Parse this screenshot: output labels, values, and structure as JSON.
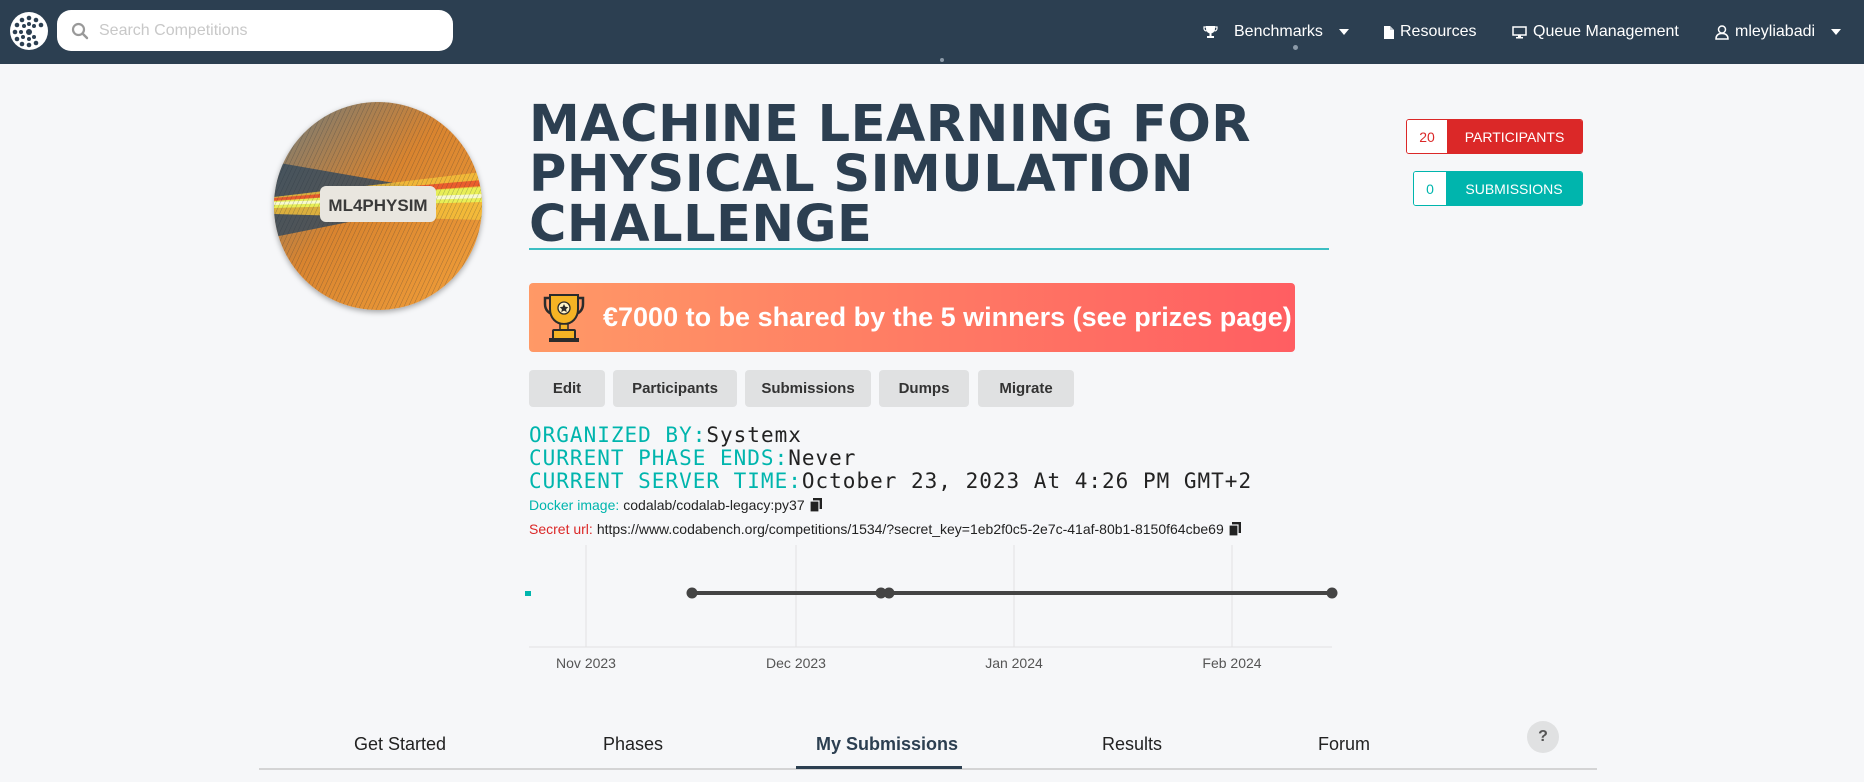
{
  "navbar": {
    "search_placeholder": "Search Competitions",
    "benchmarks_label": "Benchmarks",
    "resources_label": "Resources",
    "queue_label": "Queue Management",
    "user_label": "mleyliabadi"
  },
  "competition": {
    "logo_text": "ML4PHYSIM",
    "title": "MACHINE LEARNING FOR PHYSICAL SIMULATION CHALLENGE",
    "participants_count": "20",
    "participants_label": "PARTICIPANTS",
    "submissions_count": "0",
    "submissions_label": "SUBMISSIONS",
    "prize_text": "€7000 to be shared by the 5 winners (see prizes page)"
  },
  "actions": {
    "edit": "Edit",
    "participants": "Participants",
    "submissions": "Submissions",
    "dumps": "Dumps",
    "migrate": "Migrate"
  },
  "details": {
    "organized_by_label": "ORGANIZED BY:",
    "organized_by_value": "Systemx",
    "phase_ends_label": "CURRENT PHASE ENDS:",
    "phase_ends_value": "Never",
    "server_time_label": "CURRENT SERVER TIME:",
    "server_time_value": "October 23, 2023 At 4:26 PM GMT+2",
    "docker_label": "Docker image:",
    "docker_value": "codalab/codalab-legacy:py37",
    "secret_label": "Secret url:",
    "secret_value": "https://www.codabench.org/competitions/1534/?secret_key=1eb2f0c5-2e7c-41af-80b1-8150f64cbe69"
  },
  "timeline": {
    "ticks": [
      "Nov 2023",
      "Dec 2023",
      "Jan 2024",
      "Feb 2024"
    ]
  },
  "tabs": {
    "get_started": "Get Started",
    "phases": "Phases",
    "my_submissions": "My Submissions",
    "results": "Results",
    "forum": "Forum",
    "help": "?"
  },
  "colors": {
    "navbar": "#2c3f51",
    "teal": "#00b5ad",
    "red": "#db2828",
    "prize_start": "#ff9966",
    "prize_end": "#ff5e62"
  }
}
